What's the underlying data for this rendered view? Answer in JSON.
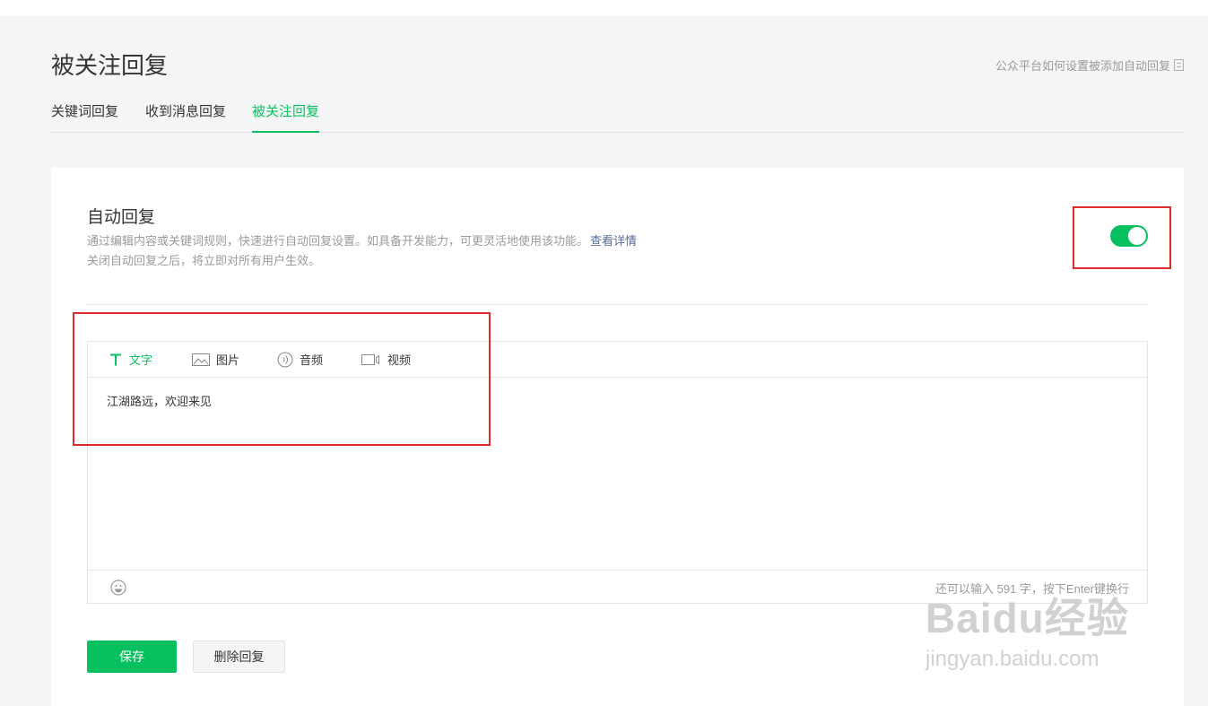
{
  "page": {
    "title": "被关注回复",
    "help_link": "公众平台如何设置被添加自动回复"
  },
  "tabs": [
    {
      "label": "关键词回复"
    },
    {
      "label": "收到消息回复"
    },
    {
      "label": "被关注回复",
      "active": true
    }
  ],
  "auto_reply": {
    "title": "自动回复",
    "description": "通过编辑内容或关键词规则，快速进行自动回复设置。如具备开发能力，可更灵活地使用该功能。",
    "detail_link": "查看详情",
    "note": "关闭自动回复之后，将立即对所有用户生效。",
    "enabled": true
  },
  "editor": {
    "tabs": [
      {
        "label": "文字",
        "icon": "text-icon",
        "active": true
      },
      {
        "label": "图片",
        "icon": "image-icon"
      },
      {
        "label": "音频",
        "icon": "audio-icon"
      },
      {
        "label": "视频",
        "icon": "video-icon"
      }
    ],
    "content": "江湖路远，欢迎来见",
    "counter": "还可以输入 591 字，按下Enter键换行"
  },
  "buttons": {
    "save": "保存",
    "delete": "删除回复"
  },
  "watermark": {
    "logo": "Baidu经验",
    "url": "jingyan.baidu.com"
  },
  "colors": {
    "accent": "#07c160",
    "highlight": "#e02b2b",
    "link": "#576b95"
  }
}
